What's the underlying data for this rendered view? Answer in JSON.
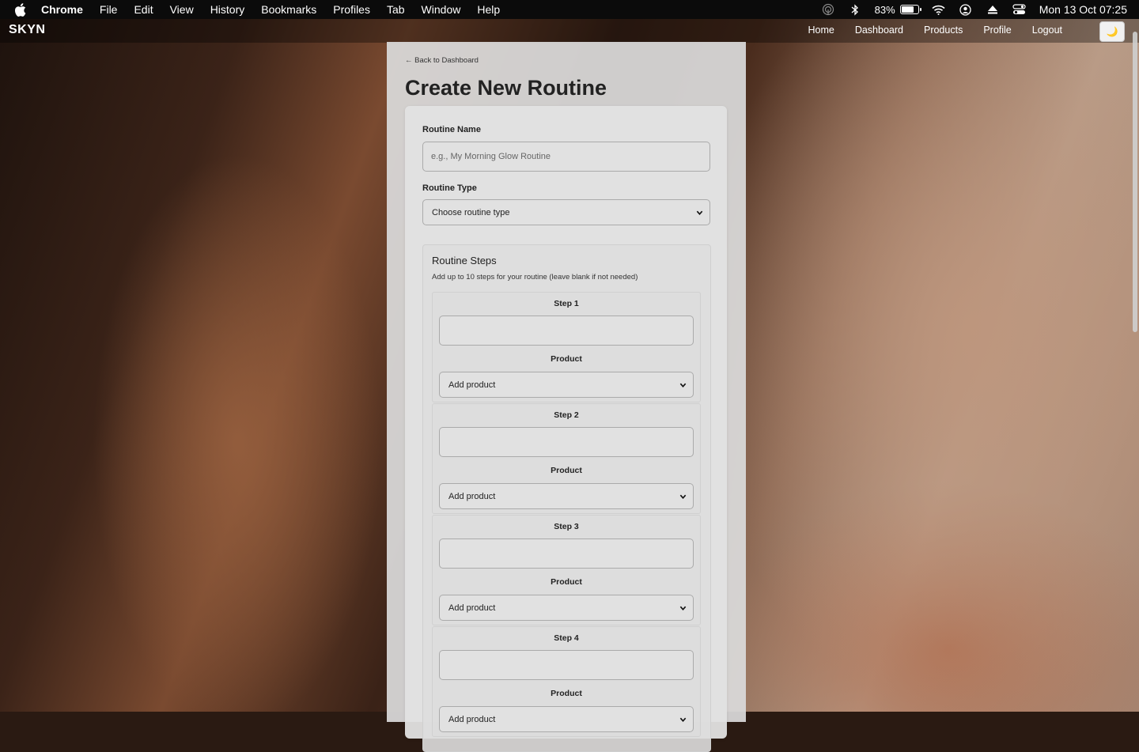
{
  "menubar": {
    "app": "Chrome",
    "items": [
      "File",
      "Edit",
      "View",
      "History",
      "Bookmarks",
      "Profiles",
      "Tab",
      "Window",
      "Help"
    ],
    "battery_percent": "83%",
    "battery_level": 0.83,
    "datetime": "Mon 13 Oct  07:25"
  },
  "site": {
    "logo": "SKYN",
    "nav": {
      "home": "Home",
      "dashboard": "Dashboard",
      "products": "Products",
      "profile": "Profile",
      "logout": "Logout"
    },
    "theme_toggle_icon": "🌙"
  },
  "page": {
    "back_link": "← Back to Dashboard",
    "title": "Create New Routine"
  },
  "form": {
    "routine_name_label": "Routine Name",
    "routine_name_placeholder": "e.g., My Morning Glow Routine",
    "routine_name_value": "",
    "routine_type_label": "Routine Type",
    "routine_type_selected": "Choose routine type",
    "steps_title": "Routine Steps",
    "steps_subtitle": "Add up to 10 steps for your routine (leave blank if not needed)",
    "steps": [
      {
        "label": "Step 1",
        "product_label": "Product",
        "product_selected": "Add product"
      },
      {
        "label": "Step 2",
        "product_label": "Product",
        "product_selected": "Add product"
      },
      {
        "label": "Step 3",
        "product_label": "Product",
        "product_selected": "Add product"
      },
      {
        "label": "Step 4",
        "product_label": "Product",
        "product_selected": "Add product"
      }
    ]
  }
}
